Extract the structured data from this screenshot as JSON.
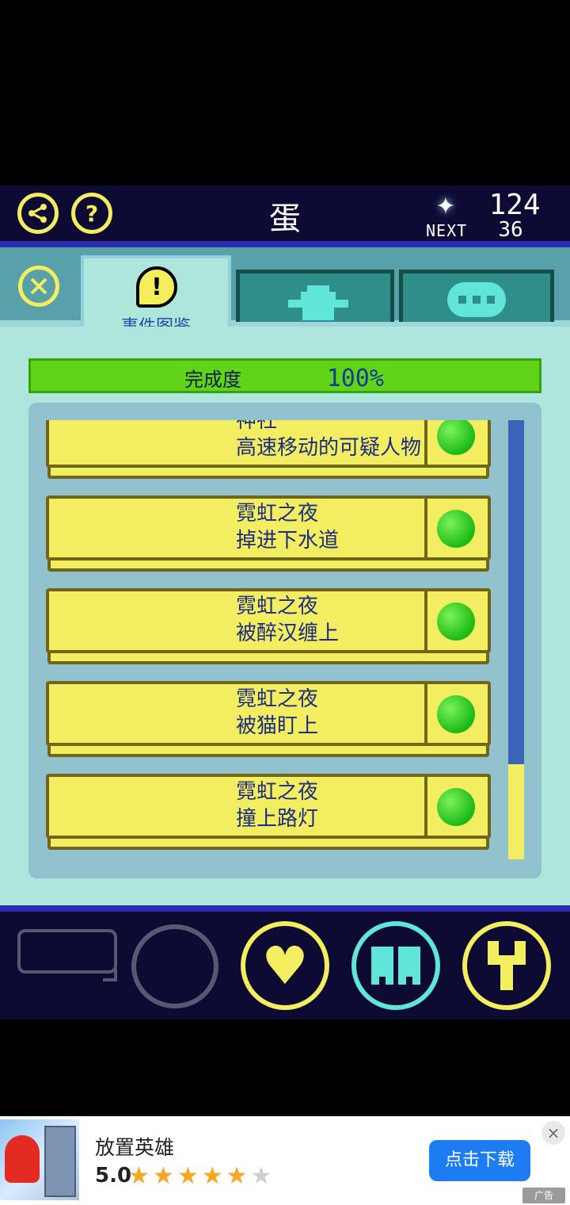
{
  "header": {
    "title": "蛋",
    "currency_count": "124",
    "next_label": "NEXT",
    "next_value": "36",
    "share_icon": "share-icon",
    "help_icon": "help-icon",
    "currency_icon": "sparkle-icon"
  },
  "tabs": {
    "close_icon": "close-icon",
    "active_label": "事件图鉴",
    "active_icon": "alert-icon",
    "other_icons": [
      "character-icon",
      "chat-bubble-icon"
    ]
  },
  "progress": {
    "label": "完成度",
    "percent_text": "100%",
    "value": 1.0
  },
  "events": [
    {
      "line1": "神社",
      "line2": "高速移动的可疑人物",
      "status": "complete"
    },
    {
      "line1": "霓虹之夜",
      "line2": "掉进下水道",
      "status": "complete"
    },
    {
      "line1": "霓虹之夜",
      "line2": "被醉汉缠上",
      "status": "complete"
    },
    {
      "line1": "霓虹之夜",
      "line2": "被猫盯上",
      "status": "complete"
    },
    {
      "line1": "霓虹之夜",
      "line2": "撞上路灯",
      "status": "complete"
    }
  ],
  "scrollbar": {
    "position_fraction": 0.78
  },
  "bottom_nav": {
    "items": [
      "speech-bubble-icon",
      "empty-slot-icon",
      "heart-icon",
      "book-icon",
      "wrench-icon"
    ]
  },
  "ad": {
    "title": "放置英雄",
    "rating": "5.0",
    "stars_filled": 5,
    "stars_total": 6,
    "cta": "点击下载",
    "tag": "广告",
    "colors": {
      "cta": "#1d7cf2",
      "star": "#f5a623"
    }
  },
  "colors": {
    "header_bg": "#0d0b33",
    "accent_yellow": "#f2ee5f",
    "accent_cyan": "#5fe6d8",
    "panel_bg": "#aee6dc",
    "progress_green": "#61d417",
    "card_yellow": "#f3ee61",
    "text_blue": "#1b2c82"
  }
}
